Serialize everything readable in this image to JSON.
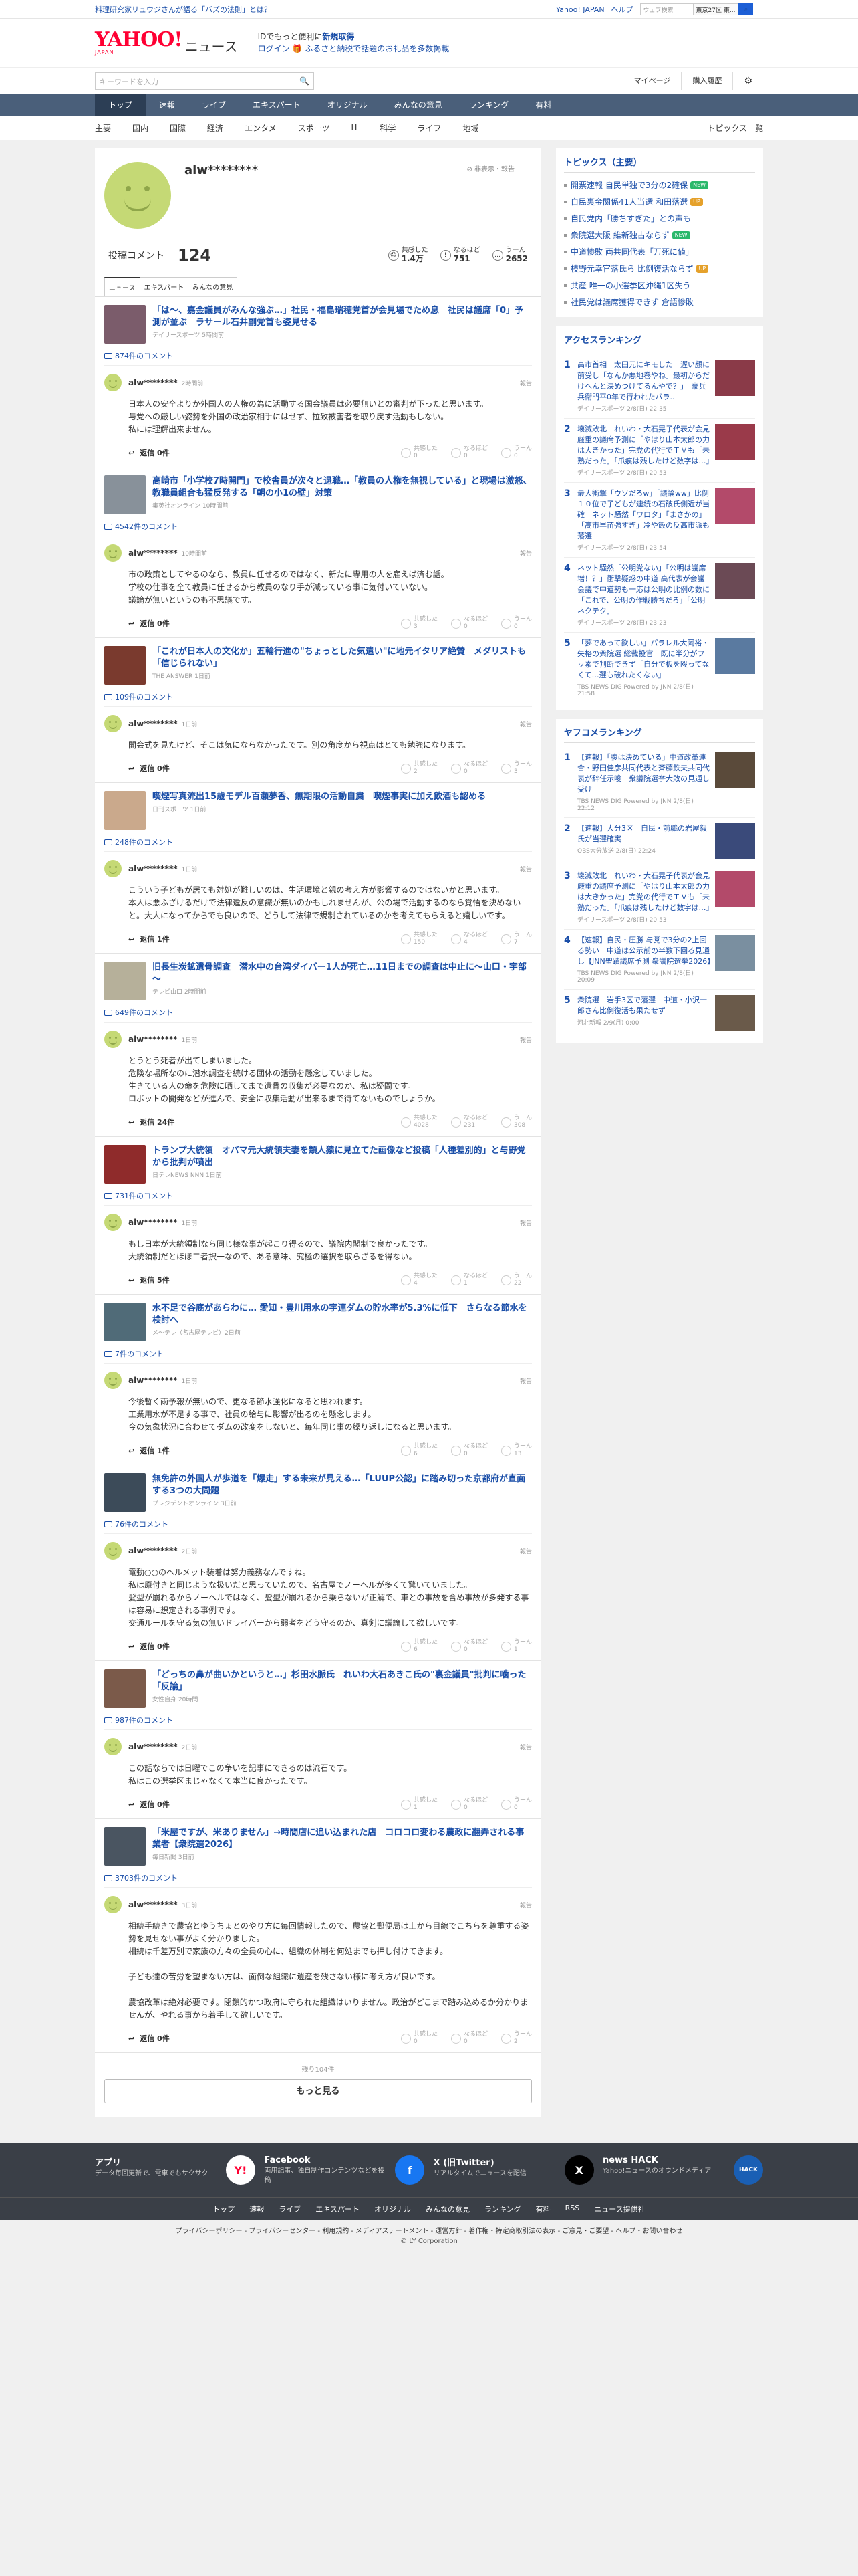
{
  "topbar": {
    "promo": "料理研究家リュウジさんが語る「バズの法則」とは？",
    "links": [
      "Yahoo! JAPAN",
      "ヘルプ"
    ],
    "web_search_placeholder": "ウェブ検索",
    "location": "東京27区 東..."
  },
  "header": {
    "logo": "YAHOO!",
    "logo_sub": "JAPAN",
    "brand": "ニュース",
    "msg1_prefix": "IDでもっと便利に",
    "msg1_link": "新規取得",
    "msg2_login": "ログイン",
    "msg2_text": "ふるさと納税で話題のお礼品を多数掲載"
  },
  "search": {
    "placeholder": "キーワードを入力",
    "mypage": "マイページ",
    "history": "購入履歴"
  },
  "nav": [
    "トップ",
    "速報",
    "ライブ",
    "エキスパート",
    "オリジナル",
    "みんなの意見",
    "ランキング",
    "有料"
  ],
  "subnav": [
    "主要",
    "国内",
    "国際",
    "経済",
    "エンタメ",
    "スポーツ",
    "IT",
    "科学",
    "ライフ",
    "地域"
  ],
  "subnav_all": "トピックス一覧",
  "profile": {
    "name": "alw********",
    "report": "非表示・報告",
    "posted_label": "投稿コメント",
    "posted_count": "124",
    "reactions": [
      {
        "label": "共感した",
        "value": "1.4万"
      },
      {
        "label": "なるほど",
        "value": "751"
      },
      {
        "label": "うーん",
        "value": "2652"
      }
    ],
    "tabs": [
      "ニュース",
      "エキスパート",
      "みんなの意見"
    ]
  },
  "entries": [
    {
      "title": "「は〜、嘉金議員がみんな強ぶ…」社民・福島瑞穂党首が会見場でため息　社民は議席「0」予測が並ぶ　ラサール石井副党首も姿見せる",
      "src": "デイリースポーツ 5時間前",
      "count": "874件のコメント",
      "user": "alw********",
      "time": "2時間前",
      "body": "日本人の安全よりか外国人の人権の為に活動する国会議員は必要無いとの審判が下ったと思います。\n与党への厳しい姿勢を外国の政治家相手にはせず、拉致被害者を取り戻す活動もしない。\n私には理解出来ません。",
      "replies": "返信 0件",
      "r": [
        "0",
        "0",
        "0"
      ]
    },
    {
      "title": "高崎市「小学校7時開門」で校舎員が次々と退職…「教員の人権を無視している」と現場は激怒、教職員組合も猛反発する「朝の小1の壁」対策",
      "src": "集英社オンライン 10時間前",
      "count": "4542件のコメント",
      "user": "alw********",
      "time": "10時間前",
      "body": "市の政策としてやるのなら、教員に任せるのではなく、新たに専用の人を雇えば済む話。\n学校の仕事を全て教員に任せるから教員のなり手が減っている事に気付いていない。\n議論が無いというのも不思議です。",
      "replies": "返信 0件",
      "r": [
        "3",
        "0",
        "0"
      ]
    },
    {
      "title": "「これが日本人の文化か」五輪行進の\"ちょっとした気遣い\"に地元イタリア絶賛　メダリストも「信じられない」",
      "src": "THE ANSWER 1日前",
      "count": "109件のコメント",
      "user": "alw********",
      "time": "1日前",
      "body": "開会式を見たけど、そこは気にならなかったです。別の角度から視点はとても勉強になります。",
      "replies": "返信 0件",
      "r": [
        "2",
        "0",
        "3"
      ]
    },
    {
      "title": "喫煙写真流出15歳モデル百瀬夢香、無期限の活動自粛　喫煙事実に加え飲酒も認める",
      "src": "日刊スポーツ 1日前",
      "count": "248件のコメント",
      "user": "alw********",
      "time": "1日前",
      "body": "こういう子どもが居ても対処が難しいのは、生活環境と親の考え方が影響するのではないかと思います。\n本人は悪ふざけるだけで法律違反の意識が無いのかもしれませんが、公の場で活動するのなら覚悟を決めないと。大人になってからでも良いので、どうして法律で規制されているのかを考えてもらえると嬉しいです。",
      "replies": "返信 1件",
      "r": [
        "150",
        "4",
        "7"
      ]
    },
    {
      "title": "旧長生炭鉱遺骨調査　潜水中の台湾ダイバー1人が死亡…11日までの調査は中止に～山口・宇部～",
      "src": "テレビ山口 2時間前",
      "count": "649件のコメント",
      "user": "alw********",
      "time": "1日前",
      "body": "とうとう死者が出てしまいました。\n危険な場所なのに潜水調査を続ける団体の活動を懸念していました。\n生きている人の命を危険に晒してまで遺骨の収集が必要なのか、私は疑問です。\nロボットの開発などが進んで、安全に収集活動が出来るまで待てないものでしょうか。",
      "replies": "返信 24件",
      "r": [
        "4028",
        "231",
        "308"
      ]
    },
    {
      "title": "トランプ大統領　オバマ元大統領夫妻を類人猿に見立てた画像など投稿「人種差別的」と与野党から批判が噴出",
      "src": "日テレNEWS NNN 1日前",
      "count": "731件のコメント",
      "user": "alw********",
      "time": "1日前",
      "body": "もし日本が大統領制なら同じ様な事が起こり得るので、議院内閣制で良かったです。\n大統領制だとほぼ二者択一なので、ある意味、究極の選択を取らざるを得ない。",
      "replies": "返信 5件",
      "r": [
        "4",
        "1",
        "22"
      ]
    },
    {
      "title": "水不足で谷底があらわに… 愛知・豊川用水の宇連ダムの貯水率が5.3%に低下　さらなる節水を検討へ",
      "src": "メ〜テレ（名古屋テレビ）2日前",
      "count": "7件のコメント",
      "user": "alw********",
      "time": "1日前",
      "body": "今後暫く雨予報が無いので、更なる節水強化になると思われます。\n工業用水が不足する事で、社員の給与に影響が出るのを懸念します。\n今の気象状況に合わせてダムの改変をしないと、毎年同じ事の繰り返しになると思います。",
      "replies": "返信 1件",
      "r": [
        "6",
        "0",
        "13"
      ]
    },
    {
      "title": "無免許の外国人が歩道を「爆走」する未来が見える…「LUUP公認」に踏み切った京都府が直面する3つの大問題",
      "src": "プレジデントオンライン 3日前",
      "count": "76件のコメント",
      "user": "alw********",
      "time": "2日前",
      "body": "電動○○のヘルメット装着は努力義務なんですね。\n私は原付きと同じような扱いだと思っていたので、名古屋でノーヘルが多くて驚いていました。\n髪型が崩れるからノーヘルではなく、髪型が崩れるから乗らないが正解で、車との事故を含め事故が多発する事は容易に想定される事例です。\n交通ルールを守る気の無いドライバーから弱者をどう守るのか、真剣に議論して欲しいです。",
      "replies": "返信 0件",
      "r": [
        "6",
        "0",
        "1"
      ]
    },
    {
      "title": "「どっちの鼻が曲いかというと…」杉田水脈氏　れいわ大石あきこ氏の\"裏金議員\"批判に噛った「反論」",
      "src": "女性自身 20時間",
      "count": "987件のコメント",
      "user": "alw********",
      "time": "2日前",
      "body": "この話ならでは日曜でこの争いを記事にできるのは流石です。\n私はこの選挙区まじゃなくて本当に良かったです。",
      "replies": "返信 0件",
      "r": [
        "1",
        "0",
        "0"
      ]
    },
    {
      "title": "「米屋ですが、米ありません」→時間店に追い込まれた店　コロコロ変わる農政に翻弄される事業者【衆院選2026】",
      "src": "毎日新聞 3日前",
      "count": "3703件のコメント",
      "user": "alw********",
      "time": "3日前",
      "body": "相続手続きで農協とゆうちょとのやり方に毎回情報したので、農協と郵便局は上から目線でこちらを尊重する姿勢を見せない事がよく分かりました。\n相続は千差万別で家族の方々の全員の心に、組織の体制を何処までも押し付けてきます。\n\n子ども達の苦労を望まない方は、面倒な組織に遺産を残さない様に考え方が良いです。\n\n農協改革は絶対必要です。閉鎖的かつ政府に守られた組織はいりません。政治がどこまで踏み込めるか分かりませんが、やれる事から着手して欲しいです。",
      "replies": "返信 0件",
      "r": [
        "0",
        "0",
        "2"
      ]
    }
  ],
  "thumb_colors": [
    "#7b5c6b",
    "#88919a",
    "#7a3a2e",
    "#caa98c",
    "#b6b09a",
    "#8f2b2b",
    "#506b78",
    "#3c4b59",
    "#7b5a4a",
    "#4a5561"
  ],
  "pager": {
    "remaining": "残り104件",
    "more": "もっと見る"
  },
  "reaction_labels": [
    "共感した",
    "なるほど",
    "うーん"
  ],
  "report": "報告",
  "topics": {
    "title": "トピックス（主要）",
    "items": [
      {
        "t": "開票速報 自民単独で3分の2確保",
        "b": "NEW"
      },
      {
        "t": "自民裏金関係41人当選 和田落選",
        "b": "UP"
      },
      {
        "t": "自民党内「勝ちすぎた」との声も",
        "b": ""
      },
      {
        "t": "衆院選大阪 維新独占ならず",
        "b": "NEW"
      },
      {
        "t": "中道惨敗 両共同代表「万死に値」",
        "b": ""
      },
      {
        "t": "枝野元幸官落氏ら 比例復活ならず",
        "b": "UP"
      },
      {
        "t": "共産 唯一の小選挙区沖縄1区失う",
        "b": ""
      },
      {
        "t": "社民党は議席獲得できず 倉語惨敗",
        "b": ""
      }
    ]
  },
  "access_rank": {
    "title": "アクセスランキング",
    "items": [
      {
        "n": "1",
        "t": "高市首相　太田元にキモした　遅い顔に前受し「なんか悪地巻やね」最初からだけへんと決めつけてるんやで？」　豪兵兵衛門平0年で行われたバラ..",
        "s": "デイリースポーツ 2/8(日) 22:35"
      },
      {
        "n": "2",
        "t": "壊滅敗北　れいわ・大石晃子代表が会見　厳重の議席予測に「やはり山本太郎の力は大きかった」完党の代行でＴＶも「未熟だった」「爪痕は残したけど数字は…」",
        "s": "デイリースポーツ 2/8(日) 20:53"
      },
      {
        "n": "3",
        "t": "最大衝撃「ウソだろw」「議論ww」比例１０位で子どもが連続の石破氏側近が当確　ネット騒然「ワロタ」「まさかの」「高市早苗強すぎ」冷や飯の反高市派も落選",
        "s": "デイリースポーツ 2/8(日) 23:54"
      },
      {
        "n": "4",
        "t": "ネット騒然「公明党ない」「公明は議席増！？」衝撃疑惑の中道 高代表が会議会議で中道勢も一応は公明の比例の数に「これで、公明の作戦勝ちだろ」「公明ネクテク」",
        "s": "デイリースポーツ 2/8(日) 23:23"
      },
      {
        "n": "5",
        "t": "「夢であって欲しい」パラレル大岡裕・失格の衆院選 総裁投官　既に半分がフッ素で判断できず「自分で板を殴ってなくて…選も破れたくない」",
        "s": "TBS NEWS DIG Powered by JNN 2/8(日) 21:58"
      }
    ]
  },
  "yafoco_rank": {
    "title": "ヤフコメランキング",
    "items": [
      {
        "n": "1",
        "t": "【速報】「腹は決めている」中道改革連合・野田佳彦共同代表と斉藤鉄夫共同代表が辞任示唆　衆議院選挙大敗の見通し受け",
        "s": "TBS NEWS DIG Powered by JNN 2/8(日) 22:12"
      },
      {
        "n": "2",
        "t": "【速報】大分3区　自民・前職の岩屋毅氏が当選確実",
        "s": "OBS大分放送 2/8(日) 22:24"
      },
      {
        "n": "3",
        "t": "壊滅敗北　れいわ・大石晃子代表が会見　厳重の議席予測に「やはり山本太郎の力は大きかった」完党の代行でＴＶも「未熟だった」「爪痕は残したけど数字は…」",
        "s": "デイリースポーツ 2/8(日) 20:53"
      },
      {
        "n": "4",
        "t": "【速報】自民・圧勝 与党で3分の2上回る勢い　中道は公示前の半数下回る見通し【JNN聖蹟議席予測 衆議院選挙2026】",
        "s": "TBS NEWS DIG Powered by JNN 2/8(日) 20:09"
      },
      {
        "n": "5",
        "t": "衆院選　岩手3区で落選　中道・小沢一郎さん比例復活も果たせず",
        "s": "河北新報 2/9(月) 0:00"
      }
    ]
  },
  "rank_colors": [
    "#8a3a48",
    "#9a3a4a",
    "#b34a6a",
    "#6b4a55",
    "#5a7aa0",
    "#5a4a3a",
    "#3a4a7a",
    "#b34a6a",
    "#7a8fa0",
    "#6a5a4a"
  ],
  "footer": {
    "apps": [
      {
        "t": "アプリ",
        "d": "データ毎回更新で、電車でもサクサク",
        "ic": "Y!"
      },
      {
        "t": "Facebook",
        "d": "両用記事、独自制作コンテンツなどを投稿",
        "ic": "f"
      },
      {
        "t": "X (旧Twitter)",
        "d": "リアルタイムでニュースを配信",
        "ic": "X"
      },
      {
        "t": "news HACK",
        "d": "Yahoo!ニュースのオウンドメディア",
        "ic": "HACK"
      }
    ],
    "nav": [
      "トップ",
      "速報",
      "ライブ",
      "エキスパート",
      "オリジナル",
      "みんなの意見",
      "ランキング",
      "有料",
      "RSS",
      "ニュース提供社"
    ],
    "links": "プライバシーポリシー - プライバシーセンター - 利用規約 - メディアステートメント - 運営方針 - 著作権・特定商取引法の表示 - ご意見・ご要望 - ヘルプ・お問い合わせ",
    "copy": "© LY Corporation"
  },
  "colors": {
    "link": "#1a4ea8",
    "nav": "#4a5f7a",
    "brand": "#ff0033",
    "avatar": "#c5d975"
  }
}
